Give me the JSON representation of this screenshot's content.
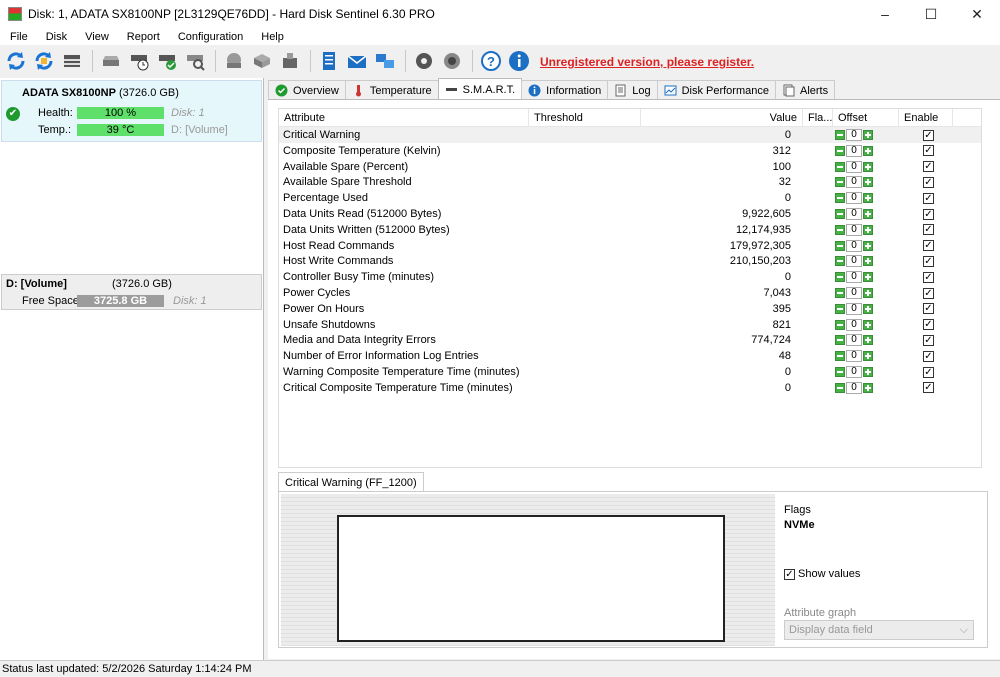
{
  "window": {
    "title": "Disk: 1, ADATA SX8100NP [2L3129QE76DD]  -  Hard Disk Sentinel 6.30 PRO",
    "minimize": "–",
    "maximize": "☐",
    "close": "✕"
  },
  "menu": [
    {
      "label": "File"
    },
    {
      "label": "Disk"
    },
    {
      "label": "View"
    },
    {
      "label": "Report"
    },
    {
      "label": "Configuration"
    },
    {
      "label": "Help"
    }
  ],
  "toolbar": {
    "register_text": "Unregistered version, please register.",
    "icons": [
      "refresh-icon",
      "refresh-all-icon",
      "disk-info-icon",
      "disk-test-icon",
      "disk-schedule-icon",
      "disk-ok-icon",
      "disk-search-icon",
      "disk-power-icon",
      "disk-tools-icon",
      "disk-usb-icon",
      "report-icon",
      "mail-icon",
      "network-icon",
      "settings-icon",
      "sound-icon",
      "help-icon",
      "info-icon"
    ]
  },
  "left": {
    "disk_name": "ADATA SX8100NP",
    "disk_size": "(3726.0 GB)",
    "health_label": "Health:",
    "health_value": "100 %",
    "health_pct": 100,
    "health_disk": "Disk: 1",
    "temp_label": "Temp.:",
    "temp_value": "39 °C",
    "temp_vol_prefix": "D:",
    "temp_vol": "[Volume]",
    "volume_name": "D: [Volume]",
    "volume_size": "(3726.0 GB)",
    "free_label": "Free Space",
    "free_value": "3725.8 GB",
    "free_disk": "Disk: 1"
  },
  "tabs": [
    {
      "label": "Overview",
      "icon": "check-icon"
    },
    {
      "label": "Temperature",
      "icon": "thermometer-icon"
    },
    {
      "label": "S.M.A.R.T.",
      "icon": "smart-icon",
      "active": true
    },
    {
      "label": "Information",
      "icon": "info-icon"
    },
    {
      "label": "Log",
      "icon": "log-icon"
    },
    {
      "label": "Disk Performance",
      "icon": "performance-icon"
    },
    {
      "label": "Alerts",
      "icon": "alerts-icon"
    }
  ],
  "smart": {
    "headers": {
      "attribute": "Attribute",
      "threshold": "Threshold",
      "value": "Value",
      "flags": "Fla...",
      "offset": "Offset",
      "enable": "Enable"
    },
    "rows": [
      {
        "attribute": "Critical Warning",
        "value": "0",
        "offset": "0"
      },
      {
        "attribute": "Composite Temperature (Kelvin)",
        "value": "312",
        "offset": "0"
      },
      {
        "attribute": "Available Spare (Percent)",
        "value": "100",
        "offset": "0"
      },
      {
        "attribute": "Available Spare Threshold",
        "value": "32",
        "offset": "0"
      },
      {
        "attribute": "Percentage Used",
        "value": "0",
        "offset": "0"
      },
      {
        "attribute": "Data Units Read (512000 Bytes)",
        "value": "9,922,605",
        "offset": "0"
      },
      {
        "attribute": "Data Units Written (512000 Bytes)",
        "value": "12,174,935",
        "offset": "0"
      },
      {
        "attribute": "Host Read Commands",
        "value": "179,972,305",
        "offset": "0"
      },
      {
        "attribute": "Host Write Commands",
        "value": "210,150,203",
        "offset": "0"
      },
      {
        "attribute": "Controller Busy Time (minutes)",
        "value": "0",
        "offset": "0"
      },
      {
        "attribute": "Power Cycles",
        "value": "7,043",
        "offset": "0"
      },
      {
        "attribute": "Power On Hours",
        "value": "395",
        "offset": "0"
      },
      {
        "attribute": "Unsafe Shutdowns",
        "value": "821",
        "offset": "0"
      },
      {
        "attribute": "Media and Data Integrity Errors",
        "value": "774,724",
        "offset": "0"
      },
      {
        "attribute": "Number of Error Information Log Entries",
        "value": "48",
        "offset": "0"
      },
      {
        "attribute": "Warning Composite Temperature Time (minutes)",
        "value": "0",
        "offset": "0"
      },
      {
        "attribute": "Critical Composite Temperature Time (minutes)",
        "value": "0",
        "offset": "0"
      }
    ]
  },
  "detail": {
    "tab_label": "Critical Warning (FF_1200)",
    "flags_label": "Flags",
    "flags_value": "NVMe",
    "show_values": "Show values",
    "attribute_graph": "Attribute graph",
    "display_field": "Display data field"
  },
  "status": {
    "text": "Status last updated: 5/2/2026 Saturday 1:14:24 PM"
  }
}
